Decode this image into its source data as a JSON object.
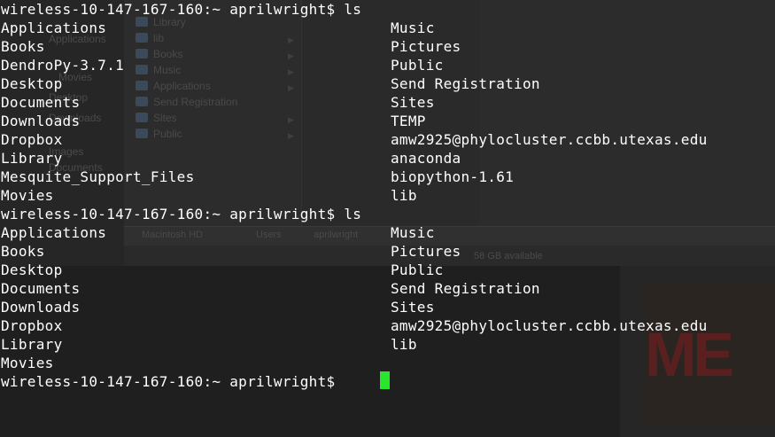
{
  "background_finder": {
    "sidebar_items": [
      "Applications",
      "Movies",
      "Desktop",
      "Downloads",
      "Images",
      "Documents"
    ],
    "list_items": [
      "Library",
      "lib",
      "Books",
      "Music",
      "Applications",
      "Send Registration",
      "Sites",
      "Public"
    ],
    "path_bar": [
      "Macintosh HD",
      "Users",
      "aprilwright"
    ],
    "status": "58 GB available"
  },
  "terminal": {
    "blocks": [
      {
        "prompt": "wireless-10-147-167-160:~ aprilwright$ ls",
        "left": [
          "Applications",
          "Books",
          "DendroPy-3.7.1",
          "Desktop",
          "Documents",
          "Downloads",
          "Dropbox",
          "Library",
          "Mesquite_Support_Files",
          "Movies"
        ],
        "right": [
          "Music",
          "Pictures",
          "Public",
          "Send Registration",
          "Sites",
          "TEMP",
          "amw2925@phylocluster.ccbb.utexas.edu",
          "anaconda",
          "biopython-1.61",
          "lib"
        ]
      },
      {
        "prompt": "wireless-10-147-167-160:~ aprilwright$ ls",
        "left": [
          "Applications",
          "Books",
          "Desktop",
          "Documents",
          "Downloads",
          "Dropbox",
          "Library",
          "Movies"
        ],
        "right": [
          "Music",
          "Pictures",
          "Public",
          "Send Registration",
          "Sites",
          "amw2925@phylocluster.ccbb.utexas.edu",
          "lib"
        ]
      }
    ],
    "current_prompt": "wireless-10-147-167-160:~ aprilwright$ ",
    "cursor_color": "#27e62d",
    "text_color": "#ffffff"
  }
}
